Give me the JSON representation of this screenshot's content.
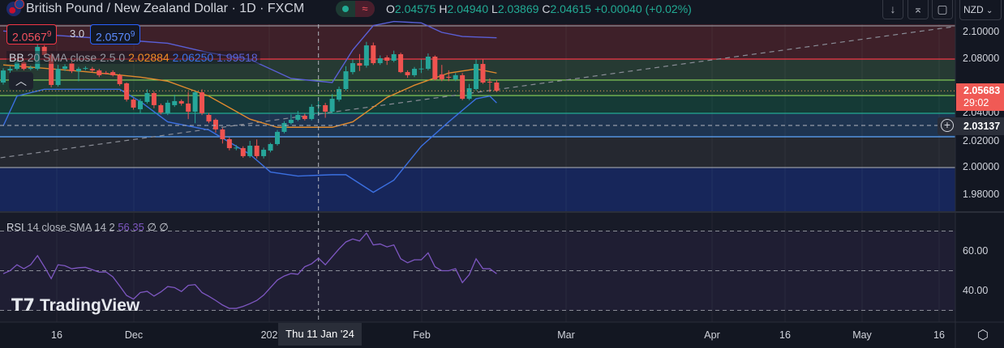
{
  "header": {
    "title": "British Pound / New Zealand Dollar · 1D · FXCM",
    "market_status_icon": "green-dot-icon",
    "replay_icon": "≈",
    "ohlc": {
      "o_label": "O",
      "o": "2.04575",
      "h_label": "H",
      "h": "2.04940",
      "l_label": "L",
      "l": "2.03869",
      "c_label": "C",
      "c": "2.04615",
      "change": "+0.00040 (+0.02%)"
    },
    "buttons": [
      "arrow-down-icon",
      "collapse-icon",
      "fullscreen-icon"
    ],
    "currency": "NZD"
  },
  "trade": {
    "sell_main": "2.0567",
    "sell_sup": "9",
    "spread": "3.0",
    "buy_main": "2.0570",
    "buy_sup": "9"
  },
  "bb_legend": {
    "label": "BB",
    "params": "20 SMA close 2.5 0",
    "basis": "2.02884",
    "upper": "2.06250",
    "lower": "1.99518"
  },
  "rsi_legend": {
    "label": "RSI",
    "params": "14 close SMA 14 2",
    "value": "56.35",
    "extra": "∅ ∅"
  },
  "price_axis": {
    "ticks": [
      "2.10000",
      "2.08000",
      "2.04000",
      "2.02000",
      "2.00000",
      "1.98000"
    ],
    "last_price": "2.05683",
    "countdown": "29:02",
    "crosshair_price": "2.03137"
  },
  "rsi_axis": {
    "ticks": [
      "60.00",
      "40.00"
    ]
  },
  "time_axis": {
    "ticks": [
      "16",
      "Dec",
      "202",
      "Feb",
      "Mar",
      "Apr",
      "16",
      "May",
      "16"
    ],
    "crosshair_label": "Thu 11 Jan '24"
  },
  "logo": "TradingView",
  "colors": {
    "up": "#26a69a",
    "down": "#ef5350",
    "bb_basis": "#e08a2e",
    "bb_band": "#3b6fe0",
    "rsi": "#7e57c2",
    "last_price": "#f05a55"
  },
  "chart_data": {
    "type": "candlestick",
    "symbol": "GBPNZD",
    "interval": "1D",
    "ylim": [
      1.97,
      2.106
    ],
    "candles_ohlc": [
      [
        2.063,
        2.0735,
        2.0615,
        2.0719
      ],
      [
        2.0719,
        2.075,
        2.07,
        2.0731
      ],
      [
        2.0731,
        2.0795,
        2.072,
        2.0779
      ],
      [
        2.0779,
        2.08,
        2.072,
        2.0731
      ],
      [
        2.0731,
        2.0755,
        2.072,
        2.074
      ],
      [
        2.0731,
        2.091,
        2.072,
        2.0893
      ],
      [
        2.0893,
        2.0905,
        2.082,
        2.0833
      ],
      [
        2.0833,
        2.0845,
        2.0595,
        2.0612
      ],
      [
        2.0612,
        2.076,
        2.06,
        2.0731
      ],
      [
        2.0731,
        2.0765,
        2.0715,
        2.0749
      ],
      [
        2.0773,
        2.079,
        2.07,
        2.0713
      ],
      [
        2.0713,
        2.0745,
        2.064,
        2.0731
      ],
      [
        2.0731,
        2.075,
        2.072,
        2.0737
      ],
      [
        2.0731,
        2.0745,
        2.0705,
        2.0719
      ],
      [
        2.0719,
        2.073,
        2.067,
        2.0684
      ],
      [
        2.0701,
        2.0715,
        2.069,
        2.07
      ],
      [
        2.0707,
        2.072,
        2.0675,
        2.0684
      ],
      [
        2.0684,
        2.0695,
        2.0605,
        2.0618
      ],
      [
        2.0624,
        2.063,
        2.049,
        2.0504
      ],
      [
        2.0504,
        2.0515,
        2.043,
        2.0445
      ],
      [
        2.0433,
        2.051,
        2.04,
        2.0493
      ],
      [
        2.0487,
        2.058,
        2.0475,
        2.0552
      ],
      [
        2.0552,
        2.0565,
        2.044,
        2.0463
      ],
      [
        2.0463,
        2.0475,
        2.0395,
        2.0409
      ],
      [
        2.0403,
        2.05,
        2.039,
        2.0481
      ],
      [
        2.0463,
        2.054,
        2.045,
        2.0493
      ],
      [
        2.0493,
        2.0505,
        2.046,
        2.0475
      ],
      [
        2.0475,
        2.056,
        2.036,
        2.0415
      ],
      [
        2.0415,
        2.057,
        2.033,
        2.0558
      ],
      [
        2.0558,
        2.058,
        2.039,
        2.0403
      ],
      [
        2.0391,
        2.0405,
        2.033,
        2.0343
      ],
      [
        2.0355,
        2.0365,
        2.026,
        2.0284
      ],
      [
        2.0284,
        2.0295,
        2.018,
        2.0212
      ],
      [
        2.0212,
        2.0225,
        2.013,
        2.0146
      ],
      [
        2.0146,
        2.017,
        2.013,
        2.015
      ],
      [
        2.0146,
        2.016,
        2.0075,
        2.0087
      ],
      [
        2.0087,
        2.02,
        2.0075,
        2.0164
      ],
      [
        2.0164,
        2.021,
        2.007,
        2.0087
      ],
      [
        2.0087,
        2.015,
        2.007,
        2.0134
      ],
      [
        2.0128,
        2.0185,
        2.0115,
        2.0176
      ],
      [
        2.0176,
        2.028,
        2.0165,
        2.0266
      ],
      [
        2.0266,
        2.0345,
        2.0255,
        2.0331
      ],
      [
        2.0331,
        2.0395,
        2.032,
        2.0355
      ],
      [
        2.0355,
        2.042,
        2.0345,
        2.0391
      ],
      [
        2.0385,
        2.04,
        2.035,
        2.0361
      ],
      [
        2.0361,
        2.047,
        2.035,
        2.0451
      ],
      [
        2.04575,
        2.0494,
        2.03869,
        2.04615
      ],
      [
        2.0463,
        2.048,
        2.037,
        2.0415
      ],
      [
        2.0415,
        2.0545,
        2.04,
        2.051
      ],
      [
        2.0504,
        2.06,
        2.049,
        2.0582
      ],
      [
        2.0582,
        2.075,
        2.057,
        2.0713
      ],
      [
        2.0707,
        2.08,
        2.069,
        2.0773
      ],
      [
        2.0773,
        2.084,
        2.0715,
        2.0755
      ],
      [
        2.0755,
        2.093,
        2.074,
        2.0904
      ],
      [
        2.0904,
        2.0925,
        2.076,
        2.0773
      ],
      [
        2.0773,
        2.083,
        2.076,
        2.0809
      ],
      [
        2.0815,
        2.083,
        2.076,
        2.0791
      ],
      [
        2.0791,
        2.0865,
        2.078,
        2.0839
      ],
      [
        2.0839,
        2.085,
        2.07,
        2.0707
      ],
      [
        2.0707,
        2.072,
        2.0665,
        2.0684
      ],
      [
        2.0684,
        2.0745,
        2.067,
        2.0731
      ],
      [
        2.0731,
        2.08,
        2.07,
        2.0733
      ],
      [
        2.0731,
        2.0845,
        2.072,
        2.0821
      ],
      [
        2.0821,
        2.083,
        2.0645,
        2.0654
      ],
      [
        2.069,
        2.076,
        2.064,
        2.0654
      ],
      [
        2.0672,
        2.072,
        2.064,
        2.067
      ],
      [
        2.0654,
        2.07,
        2.064,
        2.0684
      ],
      [
        2.0684,
        2.07,
        2.05,
        2.051
      ],
      [
        2.051,
        2.062,
        2.05,
        2.0588
      ],
      [
        2.0582,
        2.08,
        2.057,
        2.0767
      ],
      [
        2.0767,
        2.08,
        2.062,
        2.063
      ],
      [
        2.0636,
        2.066,
        2.056,
        2.0634
      ],
      [
        2.063,
        2.065,
        2.056,
        2.05683
      ]
    ],
    "bollinger": {
      "upper": [
        [
          0,
          2.101
        ],
        [
          7,
          2.098
        ],
        [
          16,
          2.095
        ],
        [
          24,
          2.092
        ],
        [
          30,
          2.085
        ],
        [
          36,
          2.08
        ],
        [
          42,
          2.066
        ],
        [
          48,
          2.063
        ],
        [
          51,
          2.087
        ],
        [
          54,
          2.105
        ],
        [
          57,
          2.108
        ],
        [
          61,
          2.107
        ],
        [
          64,
          2.1
        ],
        [
          67,
          2.097
        ],
        [
          72,
          2.096
        ]
      ],
      "basis": [
        [
          0,
          2.076
        ],
        [
          12,
          2.071
        ],
        [
          20,
          2.067
        ],
        [
          24,
          2.064
        ],
        [
          30,
          2.053
        ],
        [
          36,
          2.036
        ],
        [
          40,
          2.03
        ],
        [
          48,
          2.03
        ],
        [
          51,
          2.034
        ],
        [
          56,
          2.052
        ],
        [
          60,
          2.061
        ],
        [
          65,
          2.07
        ],
        [
          69,
          2.073
        ],
        [
          72,
          2.07
        ]
      ],
      "lower": [
        [
          0,
          2.031
        ],
        [
          2,
          2.053
        ],
        [
          6,
          2.058
        ],
        [
          17,
          2.058
        ],
        [
          20,
          2.049
        ],
        [
          24,
          2.034
        ],
        [
          30,
          2.028
        ],
        [
          36,
          2.01
        ],
        [
          39,
          1.997
        ],
        [
          43,
          1.994
        ],
        [
          48,
          1.995
        ],
        [
          50,
          1.995
        ],
        [
          54,
          1.982
        ],
        [
          57,
          1.991
        ],
        [
          61,
          2.016
        ],
        [
          65,
          2.034
        ],
        [
          69,
          2.051
        ],
        [
          71,
          2.053
        ],
        [
          72,
          2.048
        ]
      ]
    },
    "levels": [
      {
        "price": 2.1048,
        "color": "#9598a1"
      },
      {
        "price": 2.0803,
        "color": "#f23645"
      },
      {
        "price": 2.0648,
        "color": "#8bd45a"
      },
      {
        "price": 2.0534,
        "color": "#8bd45a"
      },
      {
        "price": 2.0403,
        "color": "#22ab94"
      },
      {
        "price": 2.023,
        "color": "#5ea8ff"
      },
      {
        "price": 2.0003,
        "color": "#9598a1"
      }
    ],
    "zones": [
      "#3e2029",
      "#263a33",
      "#1f3b32",
      "#153a36",
      "#1e3450",
      "#252830",
      "#17265a"
    ],
    "trendline": [
      [
        -0.4,
        2.0075
      ],
      [
        138.7,
        2.1042
      ]
    ],
    "rsi": {
      "ylim": [
        25,
        75
      ],
      "bands": [
        70,
        50,
        30
      ],
      "values": [
        48.5,
        50,
        53,
        51,
        53,
        57.6,
        52,
        46,
        53,
        52.5,
        51,
        51.5,
        51.7,
        50.5,
        49.3,
        49.4,
        46.9,
        42.3,
        37.5,
        35.7,
        39,
        39.6,
        37.2,
        39.3,
        42,
        41.5,
        39.5,
        42.6,
        43,
        39,
        37.1,
        35,
        32.7,
        31,
        31,
        32,
        33.4,
        35,
        37.7,
        41.5,
        45.3,
        47.3,
        48.6,
        48.2,
        52,
        53.5,
        56.35,
        53,
        57,
        61,
        64.5,
        66,
        65,
        69,
        63,
        63.5,
        62,
        63,
        56,
        54,
        55.5,
        55.5,
        59,
        52,
        50,
        50,
        51,
        44,
        48,
        56,
        51,
        51,
        48.5
      ]
    }
  }
}
